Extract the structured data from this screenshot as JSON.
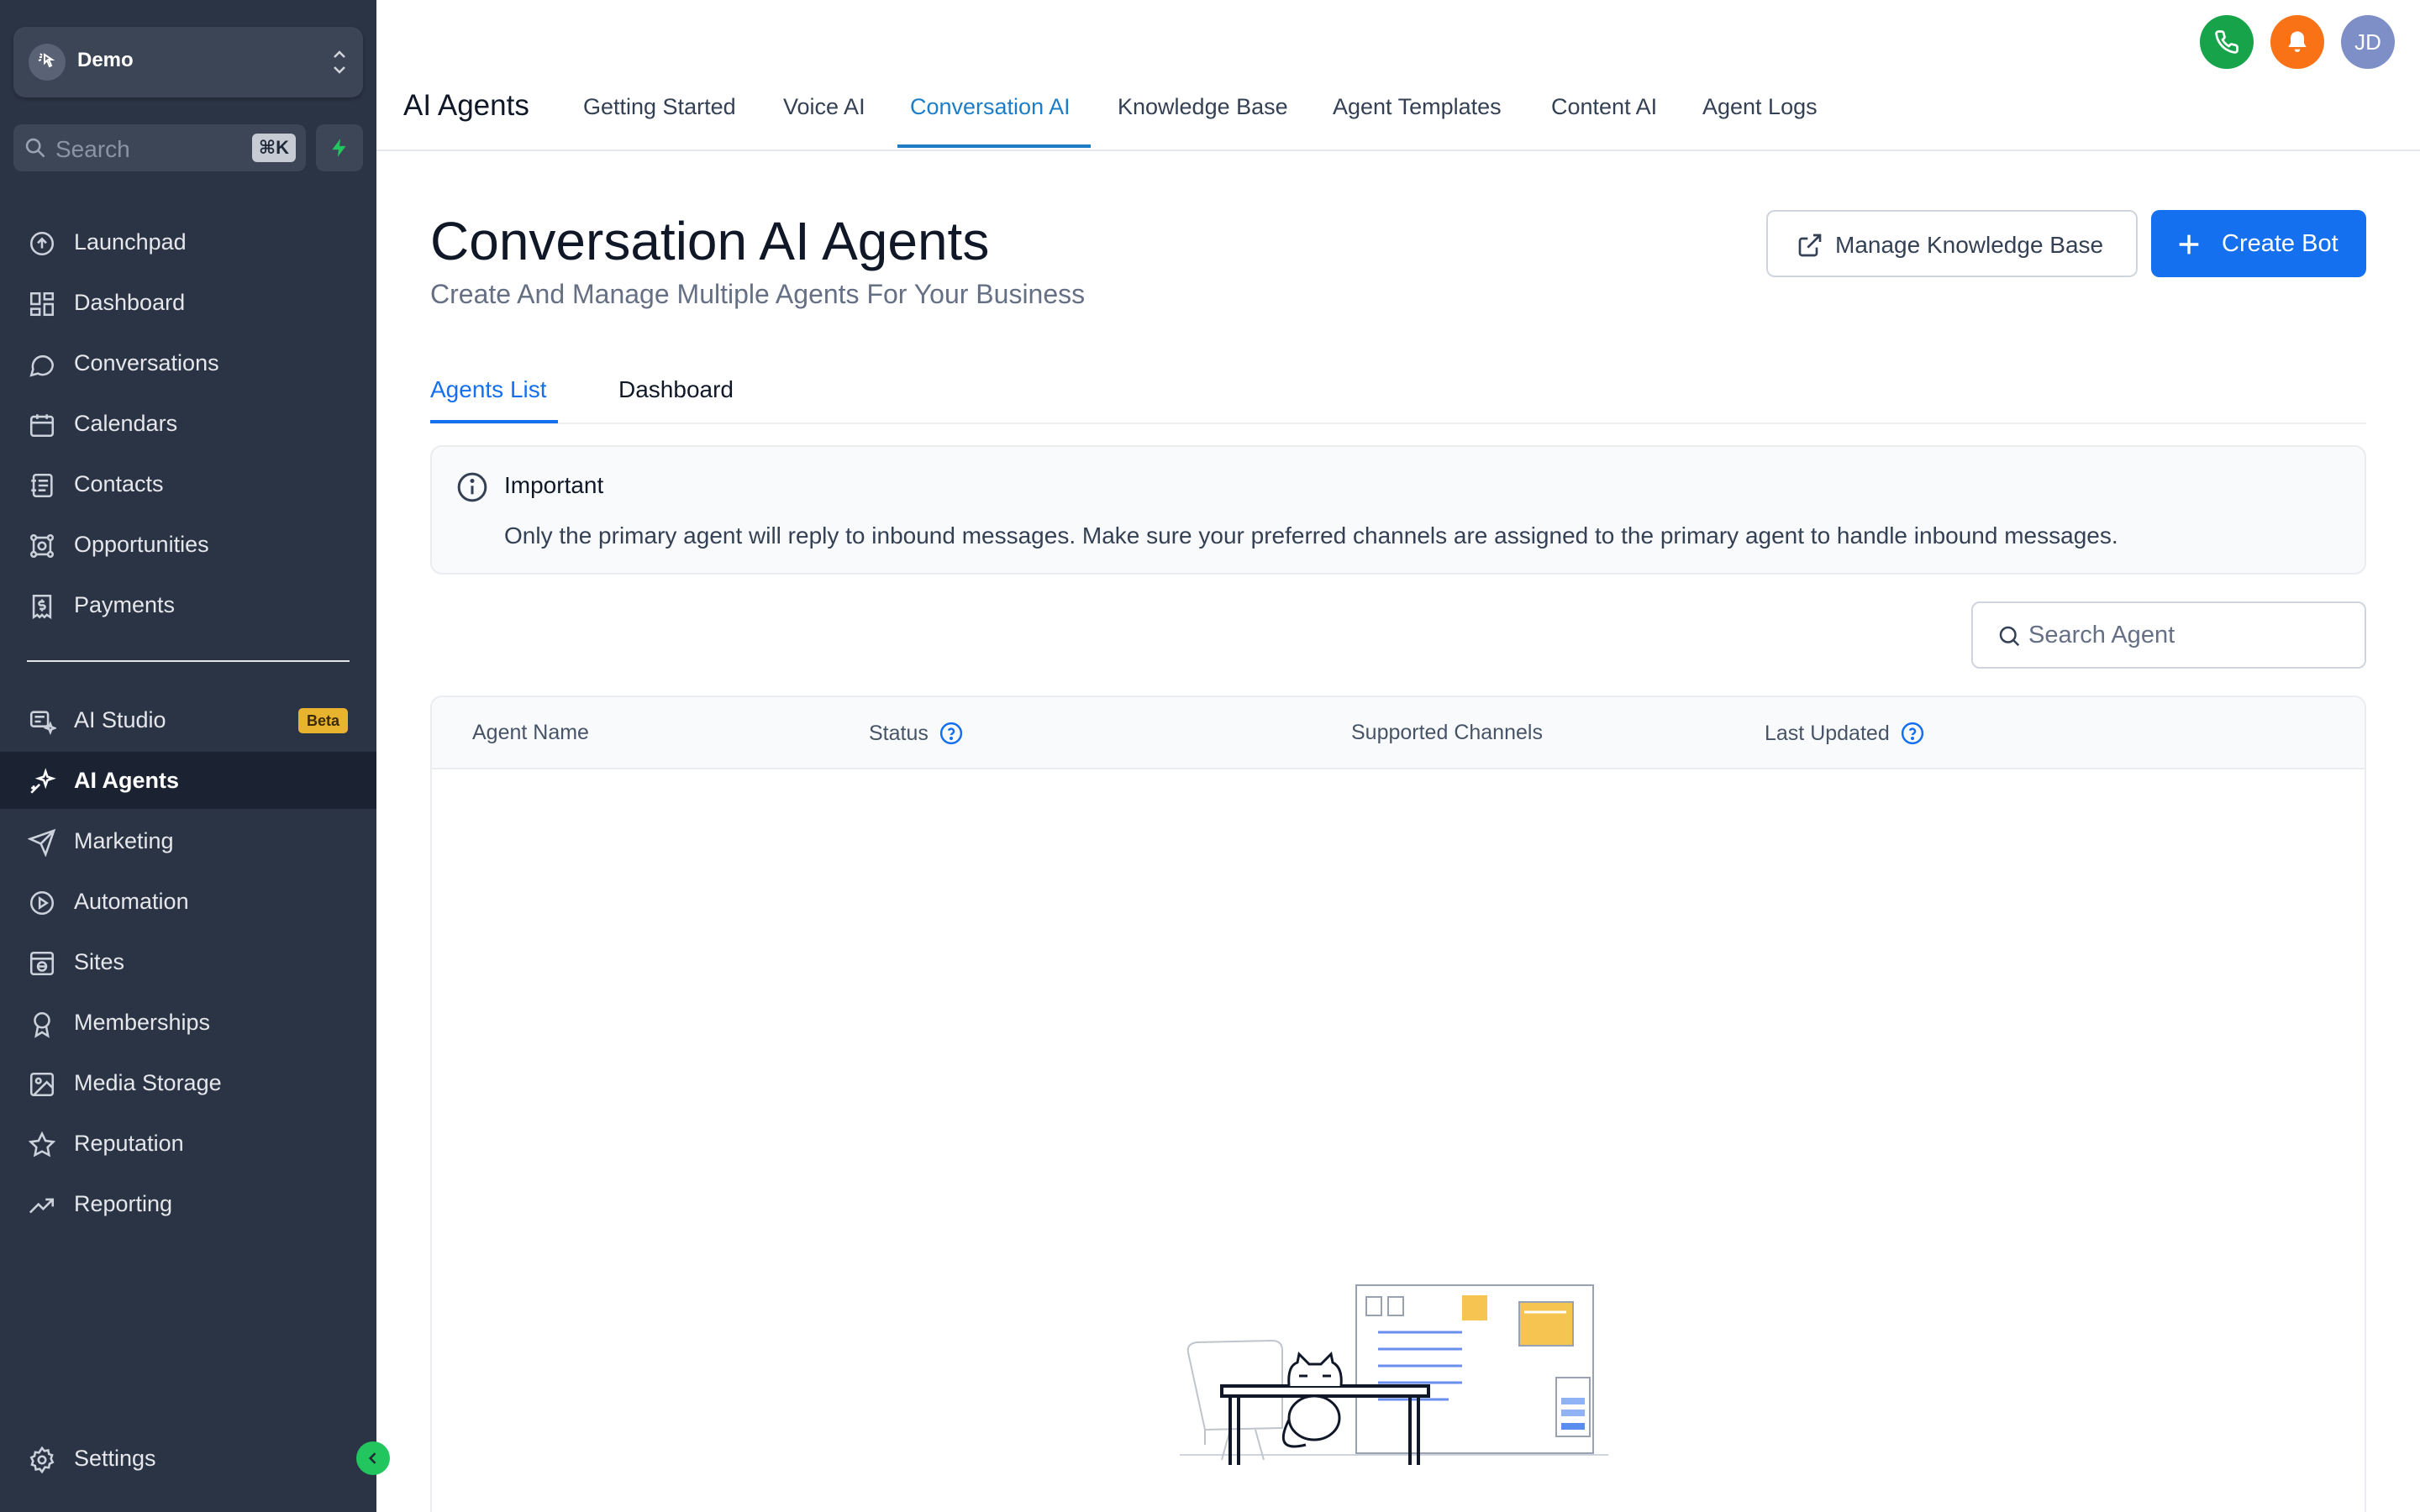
{
  "sidebar": {
    "account_name": "Demo",
    "search_placeholder": "Search",
    "search_shortcut": "⌘K",
    "items": [
      {
        "label": "Launchpad",
        "icon": "rocket-icon"
      },
      {
        "label": "Dashboard",
        "icon": "grid-icon"
      },
      {
        "label": "Conversations",
        "icon": "chat-icon"
      },
      {
        "label": "Calendars",
        "icon": "calendar-icon"
      },
      {
        "label": "Contacts",
        "icon": "contacts-icon"
      },
      {
        "label": "Opportunities",
        "icon": "opportunities-icon"
      },
      {
        "label": "Payments",
        "icon": "payments-icon"
      }
    ],
    "items2": [
      {
        "label": "AI Studio",
        "icon": "ai-studio-icon",
        "badge": "Beta"
      },
      {
        "label": "AI Agents",
        "icon": "sparkle-icon",
        "active": true
      },
      {
        "label": "Marketing",
        "icon": "send-icon"
      },
      {
        "label": "Automation",
        "icon": "automation-icon"
      },
      {
        "label": "Sites",
        "icon": "globe-icon"
      },
      {
        "label": "Memberships",
        "icon": "award-icon"
      },
      {
        "label": "Media Storage",
        "icon": "image-icon"
      },
      {
        "label": "Reputation",
        "icon": "star-icon"
      },
      {
        "label": "Reporting",
        "icon": "trend-icon"
      }
    ],
    "settings_label": "Settings"
  },
  "header": {
    "module_title": "AI Agents",
    "tabs": [
      {
        "label": "Getting Started"
      },
      {
        "label": "Voice AI"
      },
      {
        "label": "Conversation AI",
        "active": true
      },
      {
        "label": "Knowledge Base"
      },
      {
        "label": "Agent Templates"
      },
      {
        "label": "Content AI"
      },
      {
        "label": "Agent Logs"
      }
    ],
    "user_initials": "JD",
    "colors": {
      "phone": "#16a34a",
      "bell": "#f97316",
      "avatar": "#7e8fc7",
      "accent": "#1d7dc6"
    }
  },
  "main": {
    "title": "Conversation AI Agents",
    "subtitle": "Create And Manage Multiple Agents For Your Business",
    "manage_kb_label": "Manage Knowledge Base",
    "create_bot_label": "Create Bot",
    "subtabs": [
      {
        "label": "Agents List",
        "active": true
      },
      {
        "label": "Dashboard"
      }
    ],
    "alert": {
      "title": "Important",
      "text": "Only the primary agent will reply to inbound messages. Make sure your preferred channels are assigned to the primary agent to handle inbound messages."
    },
    "agent_search_placeholder": "Search Agent",
    "table": {
      "columns": [
        "Agent Name",
        "Status",
        "Supported Channels",
        "Last Updated"
      ]
    },
    "primary_color": "#1570ef"
  }
}
